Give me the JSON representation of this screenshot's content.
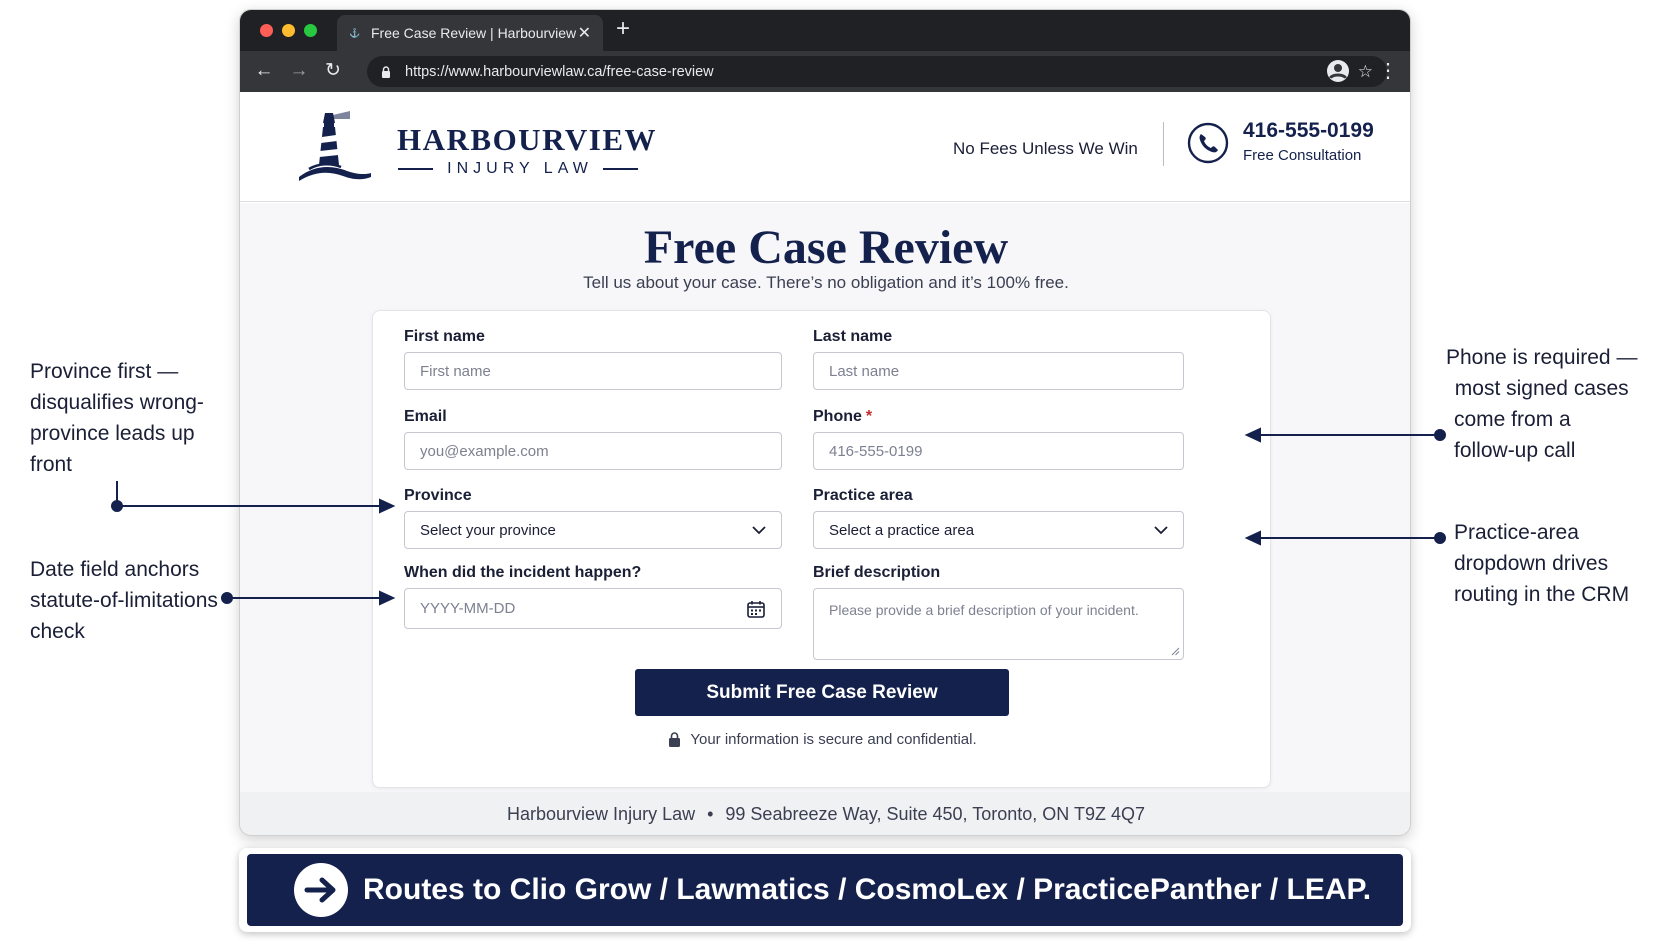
{
  "browser": {
    "tab_title": "Free Case Review | Harbourview",
    "url": "https://www.harbourviewlaw.ca/free-case-review"
  },
  "header": {
    "brand_name": "HARBOURVIEW",
    "brand_sub": "INJURY LAW",
    "tagline": "No Fees Unless We Win",
    "phone": "416-555-0199",
    "consult": "Free Consultation"
  },
  "main": {
    "title": "Free Case Review",
    "subtitle": "Tell us about your case. There’s no obligation and it’s 100% free."
  },
  "form": {
    "first_name": {
      "label": "First name",
      "placeholder": "First name"
    },
    "last_name": {
      "label": "Last name",
      "placeholder": "Last name"
    },
    "email": {
      "label": "Email",
      "placeholder": "you@example.com"
    },
    "phone": {
      "label": "Phone",
      "required_mark": "*",
      "placeholder": "416-555-0199"
    },
    "province": {
      "label": "Province",
      "value": "Select your province"
    },
    "practice_area": {
      "label": "Practice area",
      "value": "Select a practice area"
    },
    "incident_date": {
      "label": "When did the incident happen?",
      "placeholder": "YYYY-MM-DD"
    },
    "description": {
      "label": "Brief description",
      "placeholder": "Please provide a brief description of your incident."
    },
    "submit_label": "Submit Free Case Review",
    "secure_note": "Your information is secure and confidential."
  },
  "footer": {
    "firm": "Harbourview Injury Law",
    "separator": "•",
    "address": "99 Seabreeze Way, Suite 450, Toronto, ON  T9Z 4Q7"
  },
  "annotations": {
    "province_note": [
      "Province first —",
      "disqualifies wrong-",
      "province leads up",
      "front"
    ],
    "date_note": [
      "Date field anchors",
      "statute-of-limitations",
      "check"
    ],
    "phone_note": [
      "Phone is required —",
      "most signed cases",
      "come from a",
      "follow-up call"
    ],
    "practice_note": [
      "Practice-area",
      "dropdown drives",
      "routing in the CRM"
    ]
  },
  "banner": {
    "text": "Routes to Clio Grow / Lawmatics / CosmoLex / PracticePanther / LEAP."
  },
  "colors": {
    "brand_navy": "#14214d",
    "required_red": "#c62828",
    "chrome_dark": "#202124"
  },
  "icons": [
    "lighthouse-logo-icon",
    "phone-icon",
    "chevron-down-icon",
    "calendar-icon",
    "padlock-icon",
    "arrow-right-icon",
    "back-icon",
    "forward-icon",
    "reload-icon",
    "star-icon",
    "profile-icon",
    "menu-icon"
  ]
}
